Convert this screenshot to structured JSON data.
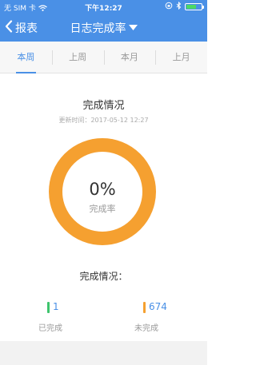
{
  "status_bar": {
    "carrier": "无 SIM 卡",
    "time": "下午12:27",
    "wifi_icon": "wifi-icon",
    "icons": [
      "lock-rotation-icon",
      "bluetooth-icon",
      "battery-icon"
    ]
  },
  "nav": {
    "back_label": "报表",
    "title": "日志完成率"
  },
  "tabs": [
    {
      "label": "本周",
      "active": true
    },
    {
      "label": "上周",
      "active": false
    },
    {
      "label": "本月",
      "active": false
    },
    {
      "label": "上月",
      "active": false
    }
  ],
  "main": {
    "section_title": "完成情况",
    "update_time": "更新时间：2017-05-12 12:27",
    "percent": "0%",
    "percent_value": 0,
    "percent_label": "完成率",
    "summary_label": "完成情况：",
    "completed": {
      "count": "1",
      "label": "已完成"
    },
    "incomplete": {
      "count": "674",
      "label": "未完成"
    }
  },
  "colors": {
    "primary": "#4a90e6",
    "ring": "#f5a030",
    "completed": "#3ec46d",
    "incomplete": "#f5a030"
  }
}
